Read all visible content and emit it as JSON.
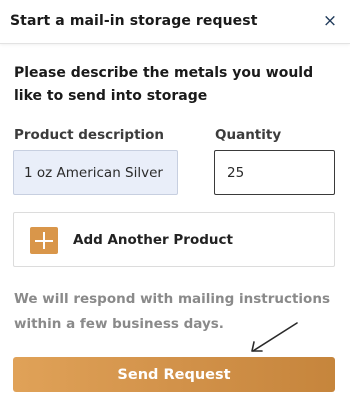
{
  "modal": {
    "title": "Start a mail-in storage request",
    "close_label": "×"
  },
  "form": {
    "intro": "Please describe the metals you would like to send into storage",
    "product_label": "Product description",
    "product_value": "1 oz American Silver",
    "quantity_label": "Quantity",
    "quantity_value": "25",
    "add_product_label": "Add Another Product",
    "note": "We will respond with mailing instructions within a few business days.",
    "submit_label": "Send Request"
  },
  "icons": {
    "close": "close-icon",
    "add": "plus-icon",
    "arrow": "arrow-icon"
  },
  "colors": {
    "accent": "#d9964a",
    "button_start": "#e0a258",
    "button_end": "#c6853c",
    "input_fill": "#e9eef9",
    "note_text": "#8a8a8a"
  }
}
